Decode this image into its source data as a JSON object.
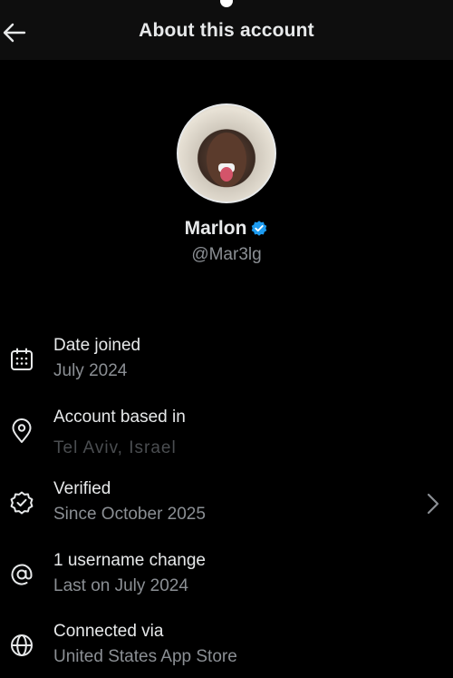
{
  "header": {
    "title": "About this account",
    "back_icon": "arrow-left-icon"
  },
  "profile": {
    "name": "Marlon",
    "handle": "@Mar3lg",
    "verified_badge_color": "#1d9bf0"
  },
  "rows": [
    {
      "icon": "calendar-icon",
      "label": "Date joined",
      "value": "July 2024"
    },
    {
      "icon": "location-pin-icon",
      "label": "Account based in",
      "value": "Tel Aviv, Israel"
    },
    {
      "icon": "verified-badge-icon",
      "label": "Verified",
      "value": "Since October 2025",
      "has_chevron": true
    },
    {
      "icon": "at-sign-icon",
      "label": "1 username change",
      "value": "Last on July 2024"
    },
    {
      "icon": "globe-icon",
      "label": "Connected via",
      "value": "United States App Store"
    }
  ],
  "colors": {
    "background": "#000000",
    "header_background": "#0e0e0e",
    "primary_text": "#e7e9ea",
    "secondary_text": "#8b8f94",
    "accent": "#1d9bf0"
  }
}
